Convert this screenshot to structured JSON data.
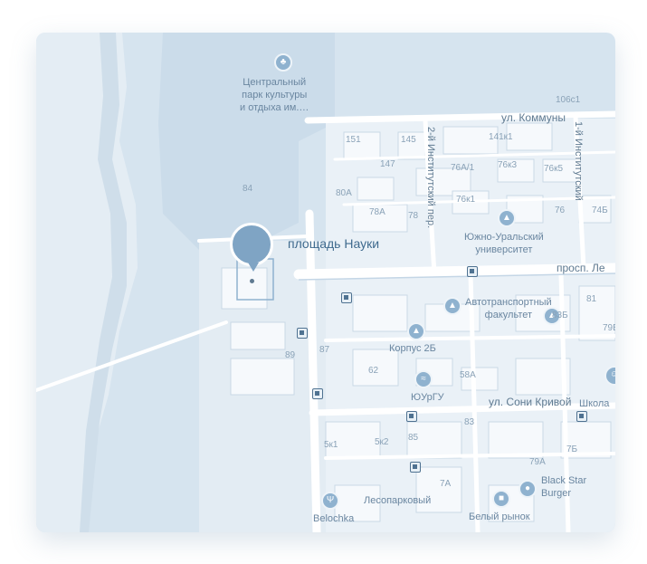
{
  "map": {
    "main_place": "площадь Науки",
    "roads": {
      "kommuny": "ул. Коммуны",
      "lenina": "просп. Ле",
      "soni_krivoy": "ул. Сони Кривой",
      "institutsky_2": "2-й Институтский пер.",
      "institutsky_1": "1-й Институтский"
    },
    "pois": {
      "park": "Центральный\nпарк культуры\nи отдыха им.…",
      "university": "Южно-Уральский\nуниверситет",
      "auto_faculty": "Автотранспортный\nфакультет",
      "korpus": "Корпус 2Б",
      "yurgu": "ЮУрГУ",
      "black_star": "Black Star\nBurger",
      "market": "Белый рынок",
      "lesoparkovy": "Лесопарковый",
      "belochka": "Belochka",
      "school": "Школа"
    },
    "house_numbers": [
      "106с1",
      "151",
      "145",
      "141к1",
      "147",
      "76А/1",
      "76к3",
      "76к5",
      "84",
      "80А",
      "76к1",
      "78А",
      "78",
      "76",
      "74Б",
      "81",
      "83Б",
      "79В",
      "87",
      "89",
      "62",
      "58А",
      "83",
      "5к1",
      "5к2",
      "85",
      "79А",
      "7А",
      "7Б"
    ]
  }
}
